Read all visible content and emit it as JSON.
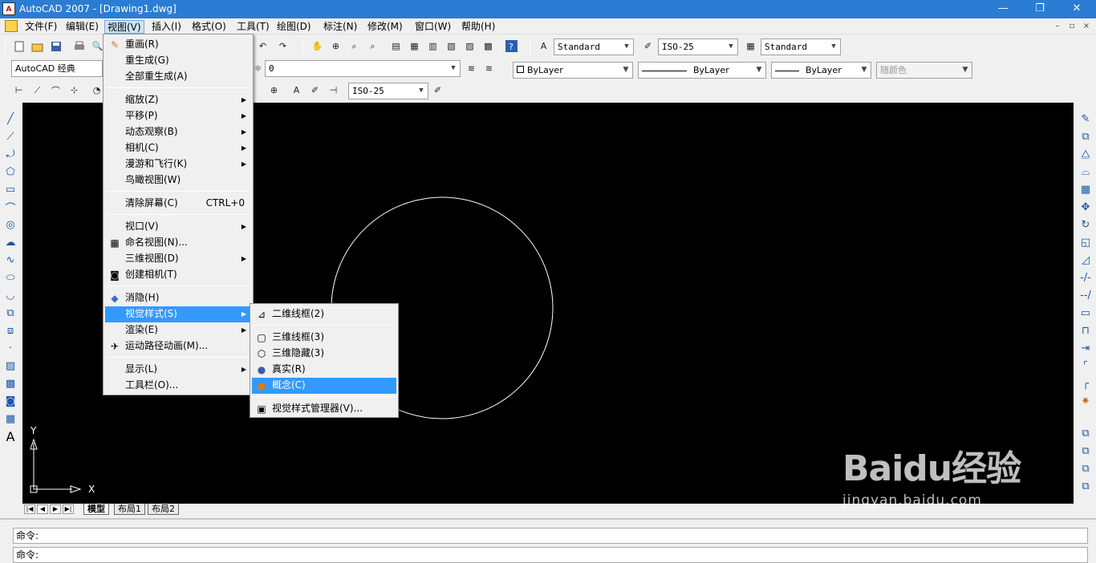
{
  "window": {
    "title": "AutoCAD 2007 - [Drawing1.dwg]",
    "app_icon": "acad",
    "minimize": "—",
    "restore": "❐",
    "close": "✕"
  },
  "menubar": {
    "items": [
      {
        "label": "文件(F)"
      },
      {
        "label": "编辑(E)"
      },
      {
        "label": "视图(V)"
      },
      {
        "label": "插入(I)"
      },
      {
        "label": "格式(O)"
      },
      {
        "label": "工具(T)"
      },
      {
        "label": "绘图(D)"
      },
      {
        "label": "标注(N)"
      },
      {
        "label": "修改(M)"
      },
      {
        "label": "窗口(W)"
      },
      {
        "label": "帮助(H)"
      }
    ],
    "active_index": 2,
    "mdi_min": "–",
    "mdi_restore": "▫",
    "mdi_close": "×"
  },
  "toolbar_styles": {
    "text_style": "Standard",
    "dim_style": "ISO-25",
    "table_style": "Standard"
  },
  "toolbar_layers": {
    "workspace": "AutoCAD 经典",
    "layer": "0",
    "color": "ByLayer",
    "linetype": "ByLayer",
    "lineweight": "ByLayer",
    "plotstyle": "随颜色"
  },
  "toolbar_dim": {
    "dim_style": "ISO-25"
  },
  "view_menu": {
    "items": [
      {
        "label": "重画(R)",
        "type": "item",
        "icon": "pencil-icon",
        "glyph": "✎"
      },
      {
        "label": "重生成(G)",
        "type": "item"
      },
      {
        "label": "全部重生成(A)",
        "type": "item"
      },
      {
        "type": "sep"
      },
      {
        "label": "缩放(Z)",
        "type": "sub"
      },
      {
        "label": "平移(P)",
        "type": "sub"
      },
      {
        "label": "动态观察(B)",
        "type": "sub"
      },
      {
        "label": "相机(C)",
        "type": "sub"
      },
      {
        "label": "漫游和飞行(K)",
        "type": "sub"
      },
      {
        "label": "鸟瞰视图(W)",
        "type": "item"
      },
      {
        "type": "sep"
      },
      {
        "label": "清除屏幕(C)",
        "type": "item",
        "shortcut": "CTRL+0"
      },
      {
        "type": "sep"
      },
      {
        "label": "视口(V)",
        "type": "sub"
      },
      {
        "label": "命名视图(N)...",
        "type": "item",
        "icon": "named-view-icon",
        "glyph": "▦"
      },
      {
        "label": "三维视图(D)",
        "type": "sub"
      },
      {
        "label": "创建相机(T)",
        "type": "item",
        "icon": "camera-icon",
        "glyph": "◙"
      },
      {
        "type": "sep"
      },
      {
        "label": "消隐(H)",
        "type": "item",
        "icon": "hide-icon",
        "glyph": "◆"
      },
      {
        "label": "视觉样式(S)",
        "type": "sub",
        "highlighted": true
      },
      {
        "label": "渲染(E)",
        "type": "sub"
      },
      {
        "label": "运动路径动画(M)...",
        "type": "item",
        "icon": "motion-path-icon",
        "glyph": "✈"
      },
      {
        "type": "sep"
      },
      {
        "label": "显示(L)",
        "type": "sub"
      },
      {
        "label": "工具栏(O)...",
        "type": "item"
      }
    ]
  },
  "visual_styles_menu": {
    "items": [
      {
        "label": "二维线框(2)",
        "type": "item",
        "icon": "2d-wireframe-icon",
        "glyph": "⊿"
      },
      {
        "type": "sep"
      },
      {
        "label": "三维线框(3)",
        "type": "item",
        "icon": "3d-wireframe-icon",
        "glyph": "▢"
      },
      {
        "label": "三维隐藏(3)",
        "type": "item",
        "icon": "3d-hidden-icon",
        "glyph": "⬡"
      },
      {
        "label": "真实(R)",
        "type": "item",
        "icon": "realistic-icon",
        "glyph": "●"
      },
      {
        "label": "概念(C)",
        "type": "item",
        "icon": "conceptual-icon",
        "glyph": "●",
        "highlighted": true
      },
      {
        "type": "sep"
      },
      {
        "label": "视觉样式管理器(V)...",
        "type": "item",
        "icon": "visual-style-manager-icon",
        "glyph": "▣"
      }
    ]
  },
  "layout_tabs": {
    "tabs": [
      "模型",
      "布局1",
      "布局2"
    ],
    "active": 0
  },
  "ucs": {
    "x_label": "X",
    "y_label": "Y"
  },
  "command": {
    "line1": "命令:",
    "line2": "命令:"
  },
  "watermark": {
    "brand": "Baidu经验",
    "url": "jingyan.baidu.com"
  },
  "colors": {
    "titlebar": "#2b7cd3",
    "highlight": "#3399ff",
    "canvas": "#000000"
  }
}
